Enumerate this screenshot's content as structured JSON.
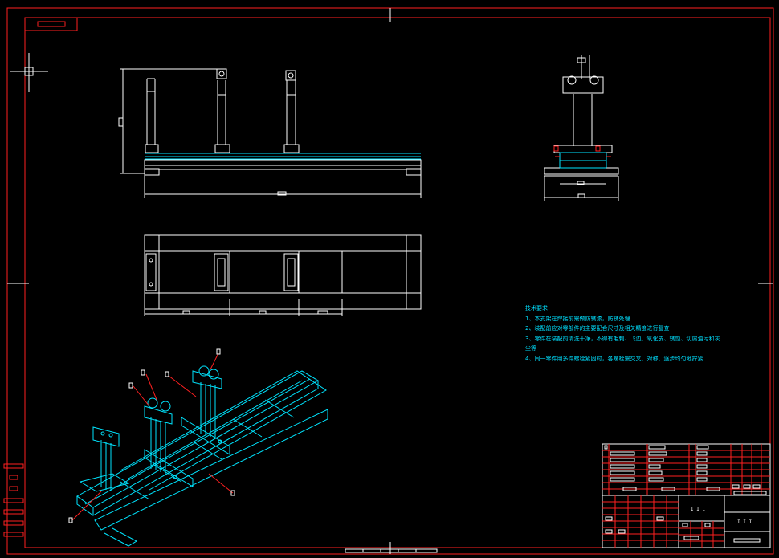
{
  "colors": {
    "background": "#000000",
    "frame": "#ff0000",
    "geometry": "#ffffff",
    "steel": "#00e5ff",
    "notes_text": "#00e0ff"
  },
  "technical_requirements": {
    "title": "技术要求",
    "items": [
      "1、本支架在焊接前需做防锈漆，防锈处理",
      "2、装配前应对零部件的主要配合尺寸及相关精度进行复查",
      "3、零件在装配前清洗干净，不得有毛刺、飞边、氧化皮、锈蚀、切屑油污和灰",
      "尘等",
      "4、同一零件用多件螺栓紧固时，各螺栓需交叉、对称、逐步均匀地拧紧"
    ]
  },
  "title_block": {
    "scale_marks": "I I I",
    "sheet_marks": "I I I"
  }
}
